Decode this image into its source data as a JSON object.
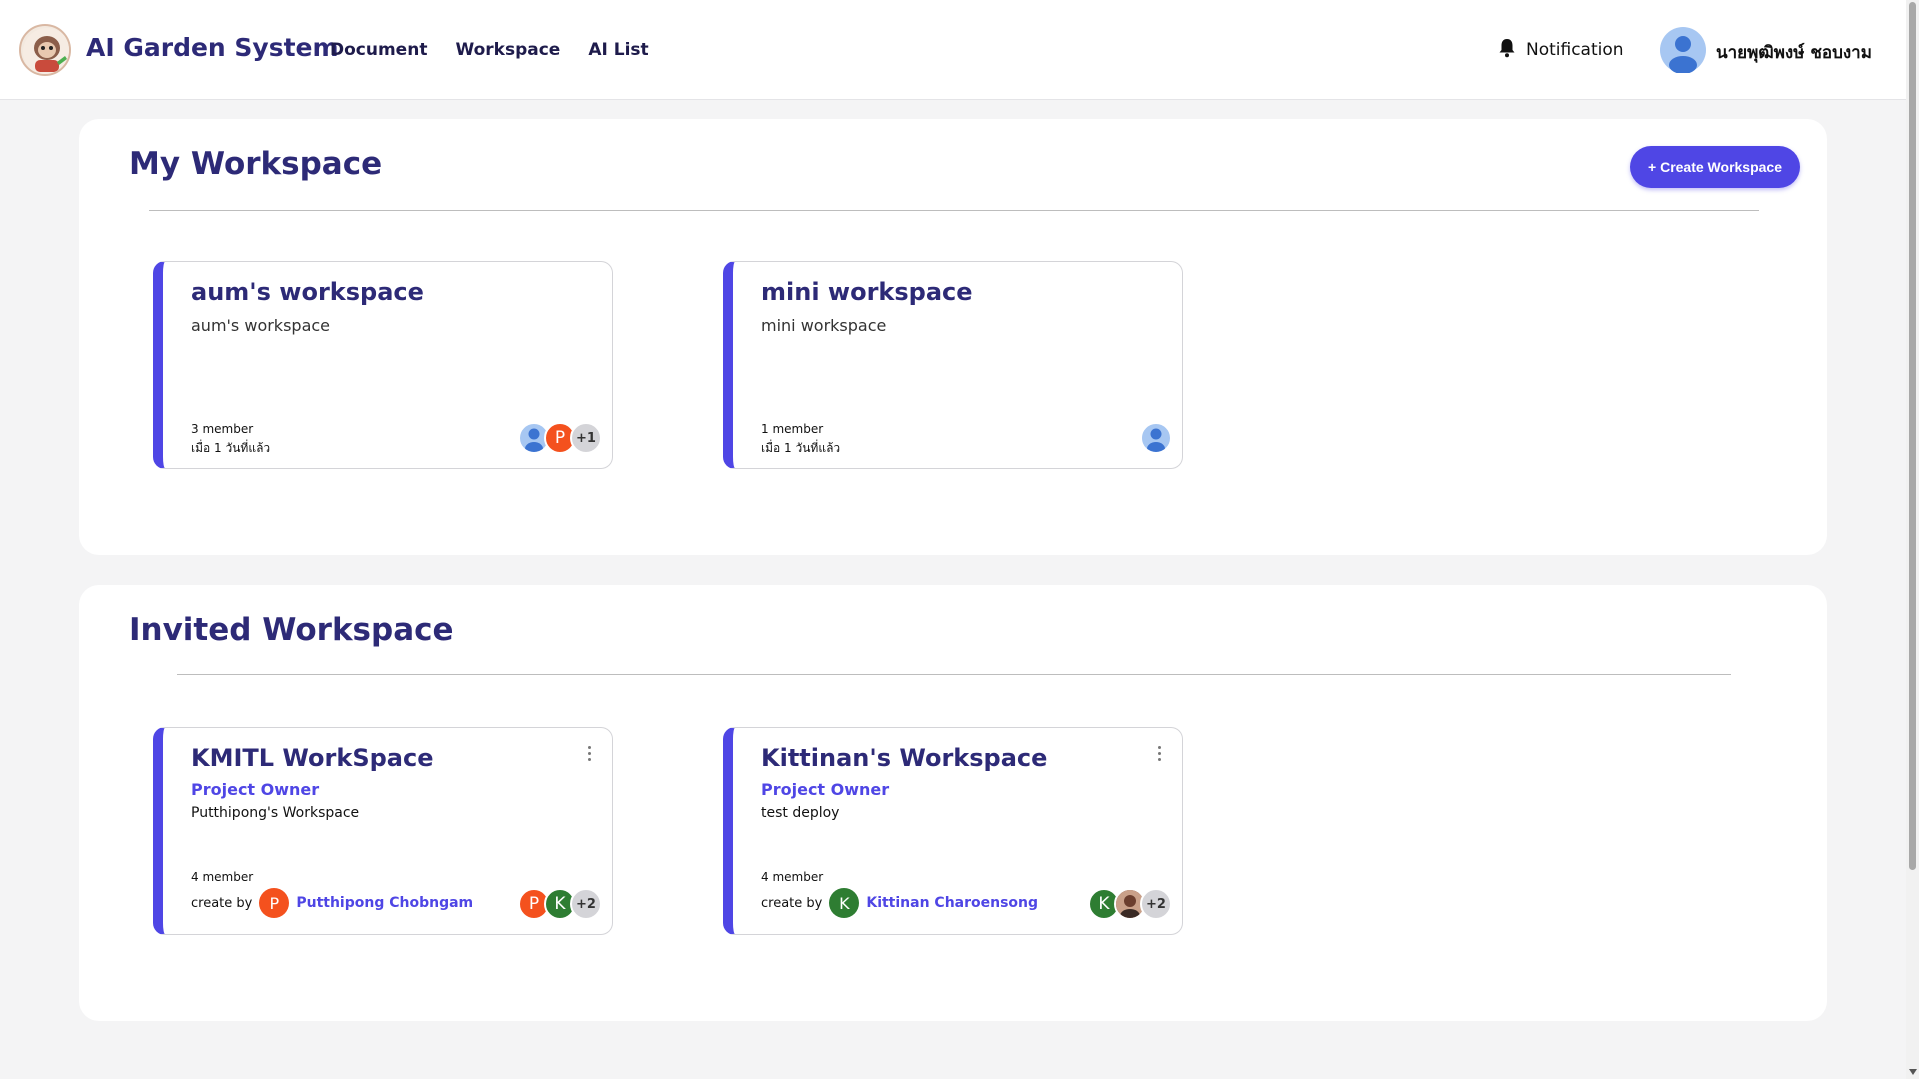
{
  "header": {
    "app_title": "AI Garden System",
    "nav": [
      "Document",
      "Workspace",
      "AI List"
    ],
    "notification_label": "Notification",
    "user_name": "นายพุฒิพงษ์ ชอบงาม"
  },
  "my_workspace": {
    "title": "My Workspace",
    "create_button": "+ Create Workspace",
    "cards": [
      {
        "title": "aum's workspace",
        "description": "aum's workspace",
        "members": "3 member",
        "time": "เมื่อ 1 วันที่แล้ว",
        "avatars": [
          {
            "type": "person-icon"
          },
          {
            "type": "initial",
            "text": "P",
            "color": "#f4511e"
          },
          {
            "type": "more",
            "text": "+1"
          }
        ]
      },
      {
        "title": "mini workspace",
        "description": "mini workspace",
        "members": "1 member",
        "time": "เมื่อ 1 วันที่แล้ว",
        "avatars": [
          {
            "type": "person-icon"
          }
        ]
      }
    ]
  },
  "invited_workspace": {
    "title": "Invited Workspace",
    "cards": [
      {
        "title": "KMITL WorkSpace",
        "role": "Project Owner",
        "description": "Putthipong's Workspace",
        "members": "4 member",
        "create_by_label": "create by",
        "creator_initial": "P",
        "creator_color": "#f4511e",
        "creator_name": "Putthipong Chobngam",
        "avatars": [
          {
            "type": "initial",
            "text": "P",
            "color": "#f4511e"
          },
          {
            "type": "initial",
            "text": "K",
            "color": "#2e7d32"
          },
          {
            "type": "more",
            "text": "+2"
          }
        ]
      },
      {
        "title": "Kittinan's Workspace",
        "role": "Project Owner",
        "description": "test deploy",
        "members": "4 member",
        "create_by_label": "create by",
        "creator_initial": "K",
        "creator_color": "#2e7d32",
        "creator_name": "Kittinan Charoensong",
        "avatars": [
          {
            "type": "initial",
            "text": "K",
            "color": "#2e7d32"
          },
          {
            "type": "photo",
            "color": "#8d5a4a"
          },
          {
            "type": "more",
            "text": "+2"
          }
        ]
      }
    ]
  },
  "colors": {
    "accent": "#4f46e5",
    "title": "#2d2a77",
    "background": "#f4f4f5"
  }
}
